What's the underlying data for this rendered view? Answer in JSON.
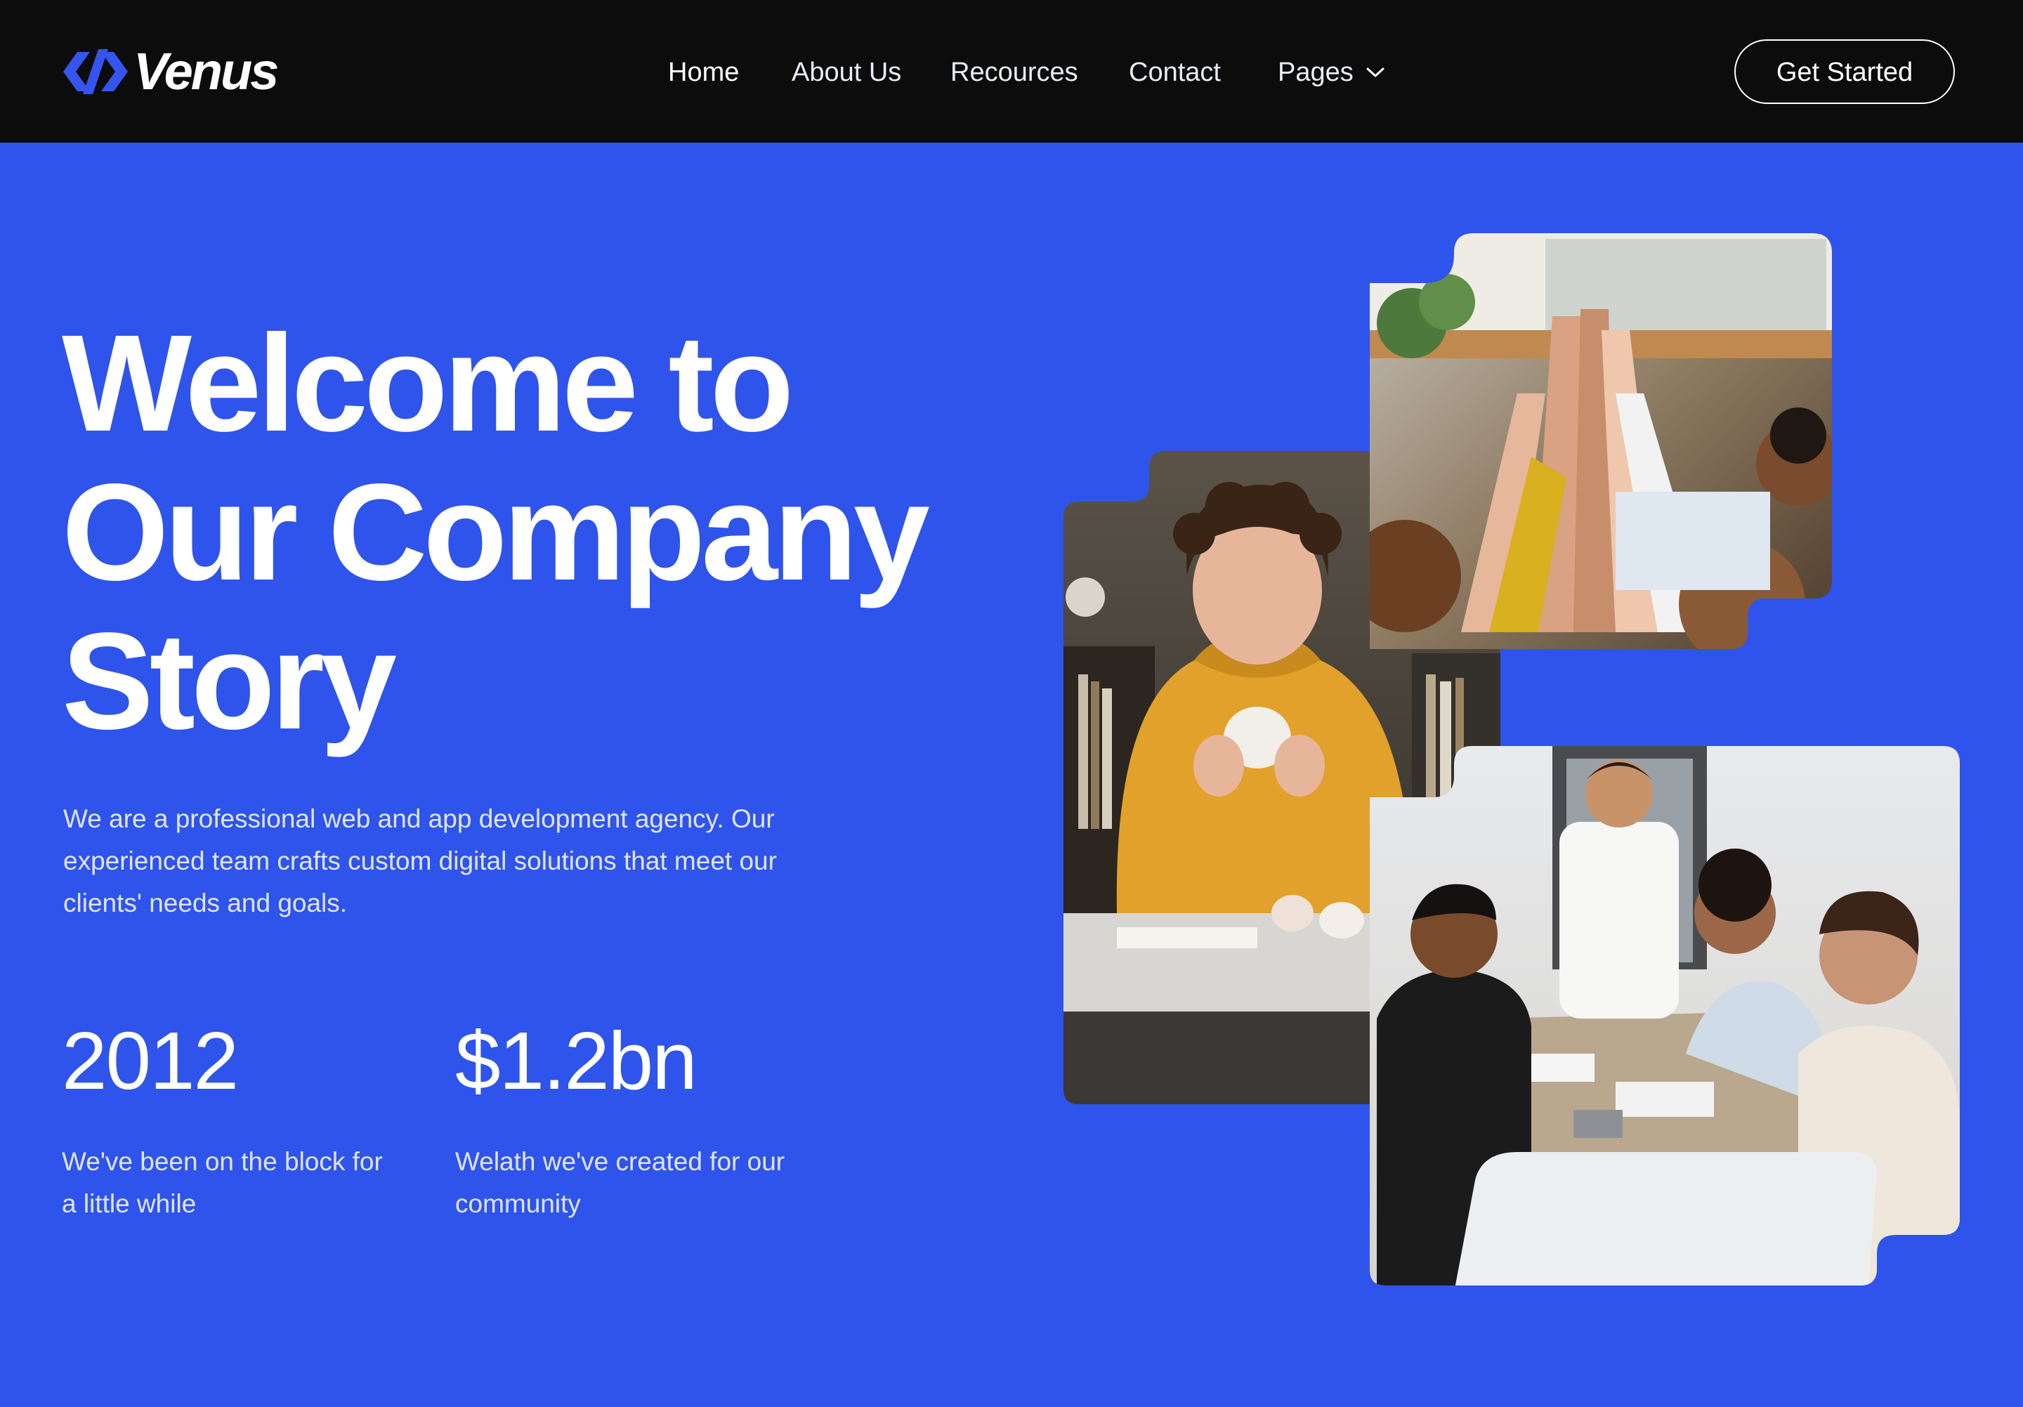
{
  "brand": {
    "name": "Venus",
    "logo_icon": "venus-code-logo-icon",
    "accent_color": "#2f54eb",
    "logo_color": "#3555f0"
  },
  "nav": {
    "items": [
      {
        "label": "Home",
        "active": true
      },
      {
        "label": "About Us"
      },
      {
        "label": "Recources"
      },
      {
        "label": "Contact"
      },
      {
        "label": "Pages",
        "icon": "chevron-down-icon"
      }
    ],
    "cta_label": "Get Started"
  },
  "hero": {
    "title_lines": [
      "Welcome to",
      "Our Company",
      "Story"
    ],
    "description": "We are a professional web and app development agency. Our experienced team crafts custom digital solutions that meet our clients' needs and goals."
  },
  "stats": [
    {
      "value": "2012",
      "label": "We've been on the block for a little while"
    },
    {
      "value": "$1.2bn",
      "label": "Welath we've created for our community"
    }
  ],
  "photos": [
    {
      "name": "team-high-five-photo"
    },
    {
      "name": "man-yellow-sweater-photo"
    },
    {
      "name": "team-meeting-table-photo"
    }
  ]
}
